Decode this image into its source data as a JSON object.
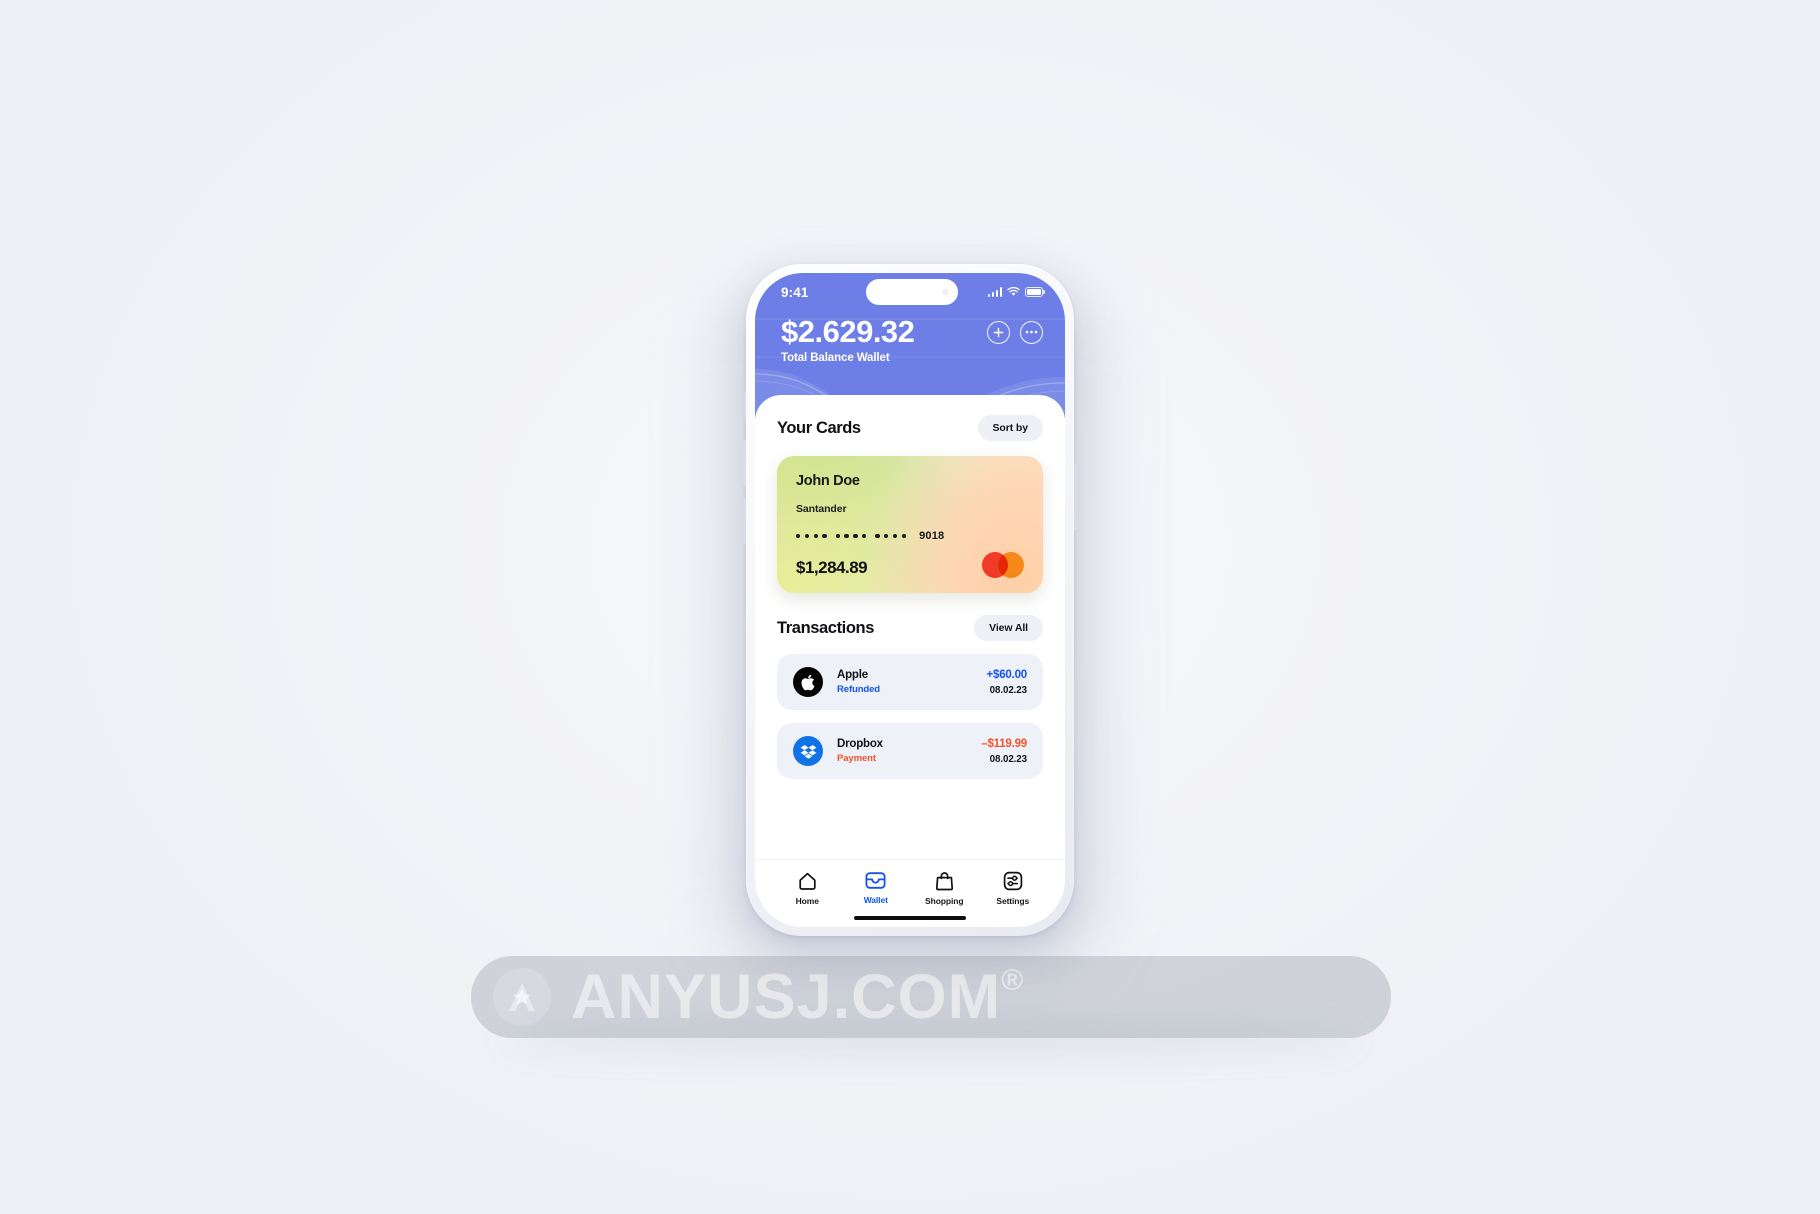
{
  "page": {
    "background_color": "#f4f5f9"
  },
  "phone": {
    "status_bar": {
      "time": "9:41",
      "cellular_icon": "signal-bars-icon",
      "wifi_icon": "wifi-icon",
      "battery_icon": "battery-icon",
      "dynamic_island": "dynamic-island"
    },
    "header": {
      "background_color": "#6d7ee6",
      "balance_amount": "$2.629.32",
      "balance_label": "Total Balance Wallet",
      "actions": [
        {
          "name": "add-button",
          "icon": "plus-circle-icon"
        },
        {
          "name": "more-button",
          "icon": "ellipsis-circle-icon"
        }
      ]
    },
    "cards_section": {
      "title": "Your Cards",
      "sort_label": "Sort by",
      "card": {
        "holder_name": "John Doe",
        "bank": "Santander",
        "masked_groups": [
          "••••",
          "••••",
          "••••"
        ],
        "last_four": "9018",
        "amount": "$1,284.89",
        "network_icon": "mastercard-icon",
        "network_colors": {
          "red": "#ef3b27",
          "orange": "#f5a623"
        }
      }
    },
    "transactions_section": {
      "title": "Transactions",
      "view_all_label": "View All",
      "items": [
        {
          "merchant": "Apple",
          "icon": "apple-logo-icon",
          "icon_bg": "#050505",
          "type": "Refunded",
          "amount": "+$60.00",
          "date": "08.02.23",
          "direction": "positive",
          "color": "#1552e8"
        },
        {
          "merchant": "Dropbox",
          "icon": "dropbox-logo-icon",
          "icon_bg": "#0f72e5",
          "type": "Payment",
          "amount": "–$119.99",
          "date": "08.02.23",
          "direction": "negative",
          "color": "#f2542c"
        }
      ]
    },
    "bottom_nav": {
      "active_color": "#1552e8",
      "items": [
        {
          "label": "Home",
          "icon": "home-icon",
          "active": false
        },
        {
          "label": "Wallet",
          "icon": "wallet-icon",
          "active": true
        },
        {
          "label": "Shopping",
          "icon": "shopping-bag-icon",
          "active": false
        },
        {
          "label": "Settings",
          "icon": "sliders-settings-icon",
          "active": false
        }
      ]
    }
  },
  "watermark": {
    "text": "ANYUSJ.COM",
    "registered_mark": "®",
    "logo_icon": "star-a-logo-icon"
  }
}
